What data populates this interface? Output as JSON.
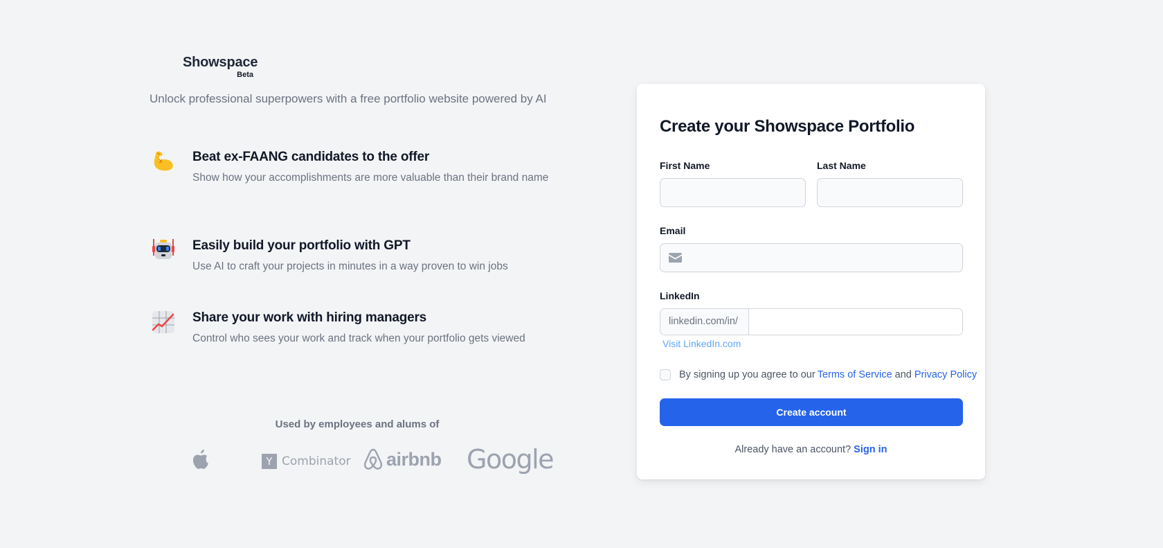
{
  "brand": {
    "name": "Showspace",
    "badge": "Beta",
    "tagline": "Unlock professional superpowers with a free portfolio website powered by AI"
  },
  "features": [
    {
      "icon": "flexed-biceps-icon",
      "title": "Beat ex-FAANG candidates to the offer",
      "description": "Show how your accomplishments are more valuable than their brand name"
    },
    {
      "icon": "robot-icon",
      "title": "Easily build your portfolio with GPT",
      "description": "Use AI to craft your projects in minutes in a way proven to win jobs"
    },
    {
      "icon": "chart-increasing-icon",
      "title": "Share your work with hiring managers",
      "description": "Control who sees your work and track when your portfolio gets viewed"
    }
  ],
  "social_proof": {
    "heading": "Used by employees and alums of",
    "logos": [
      "Apple",
      "Y Combinator",
      "airbnb",
      "Google"
    ],
    "yc_letter": "Y",
    "yc_text": "Combinator",
    "airbnb_text": "airbnb",
    "google_text": "Google"
  },
  "form": {
    "title": "Create your Showspace Portfolio",
    "first_name": {
      "label": "First Name",
      "value": "",
      "placeholder": ""
    },
    "last_name": {
      "label": "Last Name",
      "value": "",
      "placeholder": ""
    },
    "email": {
      "label": "Email",
      "value": "",
      "placeholder": "",
      "icon": "envelope-icon"
    },
    "linkedin": {
      "label": "LinkedIn",
      "prefix": "linkedin.com/in/",
      "value": "",
      "placeholder": "",
      "visit_link": "Visit LinkedIn.com"
    },
    "terms": {
      "checked": false,
      "text_before": "By signing up you agree to our",
      "terms_link": "Terms of Service",
      "and": "and",
      "privacy_link": "Privacy Policy"
    },
    "submit_label": "Create account",
    "signin_prompt": "Already have an account?",
    "signin_link": "Sign in"
  },
  "colors": {
    "background": "#f3f4f6",
    "primary": "#2563eb",
    "link_light": "#60a5fa",
    "text_muted": "#6b7280",
    "logo_gray": "#9ca3af"
  }
}
